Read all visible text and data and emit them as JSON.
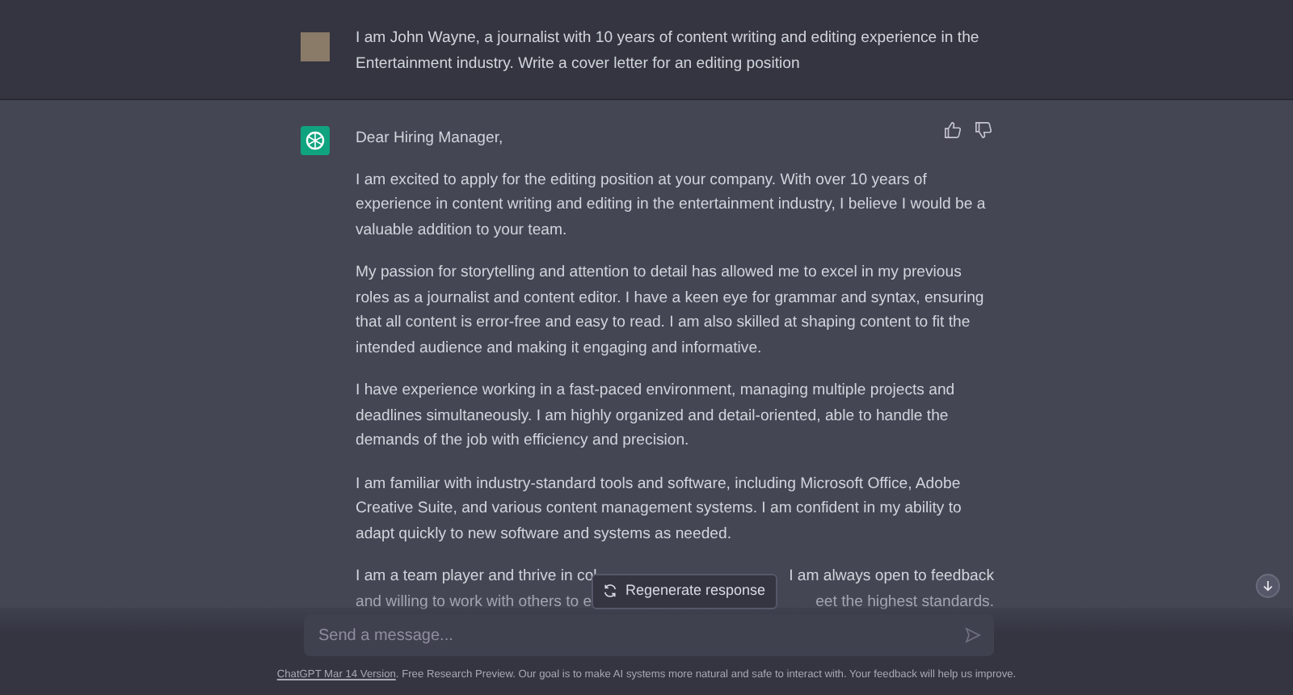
{
  "user_message": {
    "text": "I am John Wayne, a journalist with 10 years of content writing and editing experience in the Entertainment industry. Write a cover letter for an editing position"
  },
  "assistant_message": {
    "greeting": "Dear Hiring Manager,",
    "paragraphs": [
      "I am excited to apply for the editing position at your company. With over 10 years of experience in content writing and editing in the entertainment industry, I believe I would be a valuable addition to your team.",
      "My passion for storytelling and attention to detail has allowed me to excel in my previous roles as a journalist and content editor. I have a keen eye for grammar and syntax, ensuring that all content is error-free and easy to read. I am also skilled at shaping content to fit the intended audience and making it engaging and informative.",
      "I have experience working in a fast-paced environment, managing multiple projects and deadlines simultaneously. I am highly organized and detail-oriented, able to handle the demands of the job with efficiency and precision.",
      "I am familiar with industry-standard tools and software, including Microsoft Office, Adobe Creative Suite, and various content management systems. I am confident in my ability to adapt quickly to new software and systems as needed."
    ],
    "partly_covered_lines": [
      {
        "left": "I am a team player and thrive in col",
        "right": "I am always open to feedback"
      },
      {
        "left": "and willing to work with others to e",
        "right": "eet the highest standards."
      }
    ]
  },
  "regenerate_button": {
    "label": "Regenerate response"
  },
  "message_input": {
    "placeholder": "Send a message..."
  },
  "footer": {
    "link": "ChatGPT Mar 14 Version",
    "text": ". Free Research Preview. Our goal is to make AI systems more natural and safe to interact with. Your feedback will help us improve."
  }
}
